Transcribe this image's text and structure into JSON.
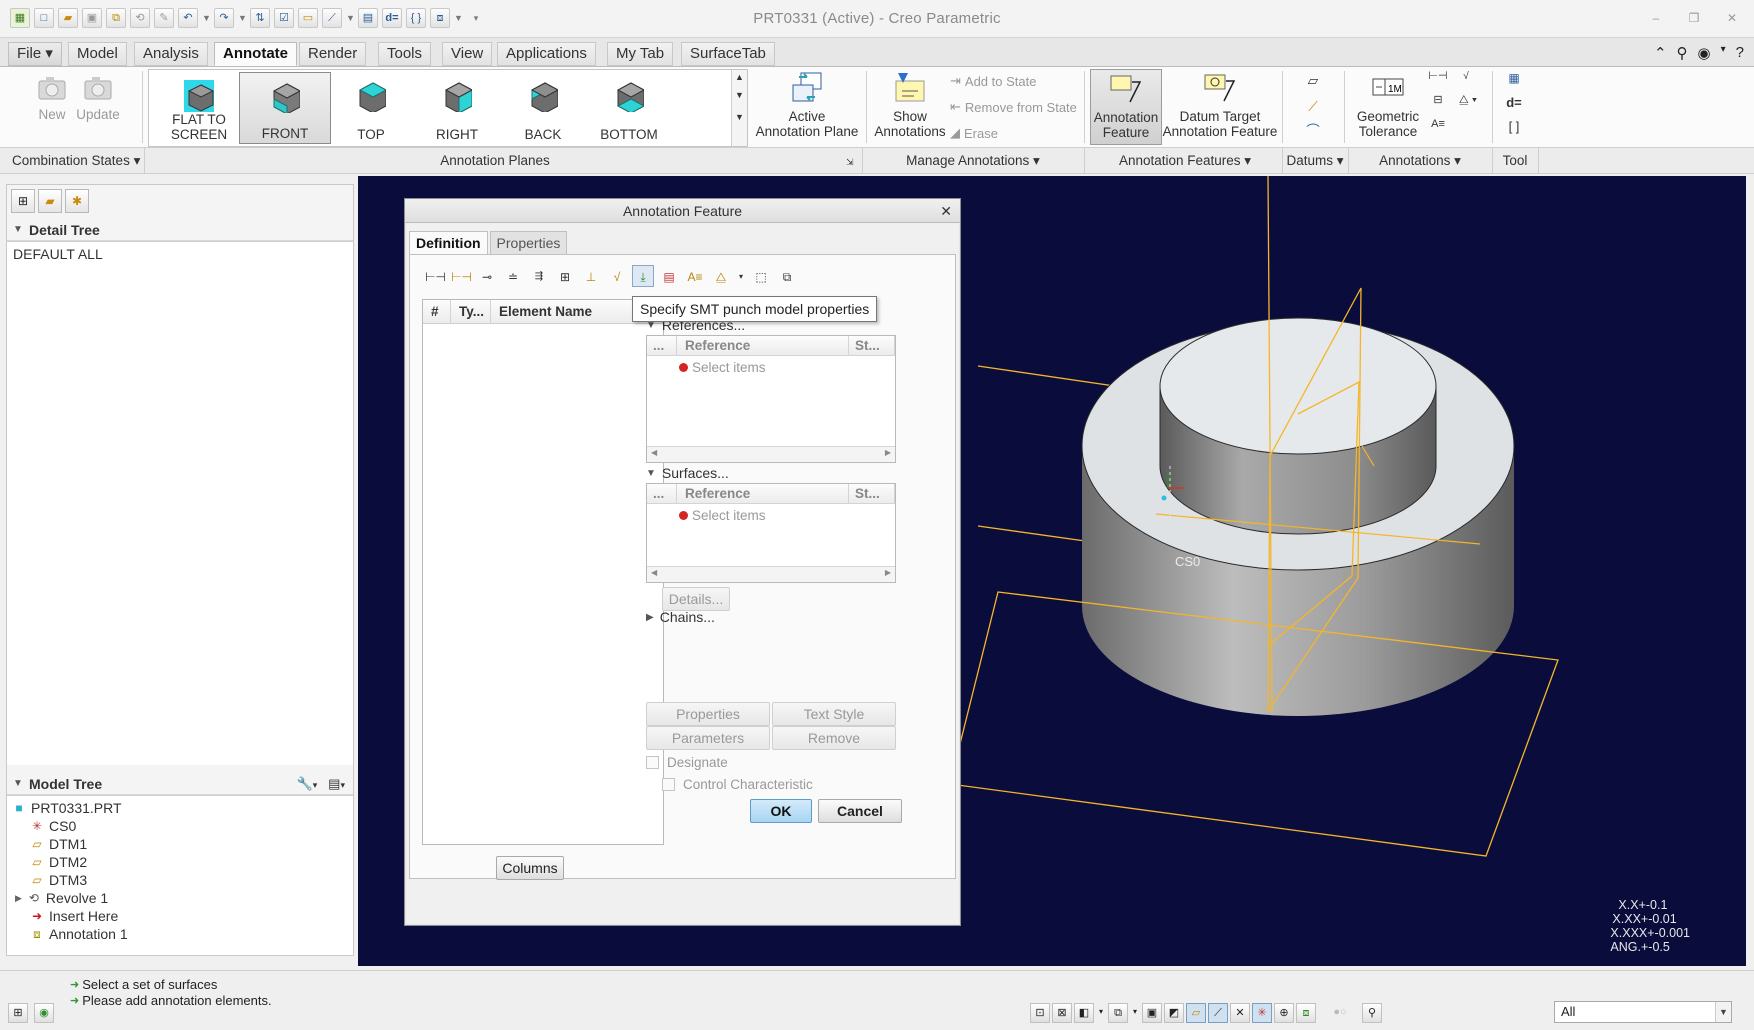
{
  "window": {
    "title": "PRT0331 (Active) - Creo Parametric"
  },
  "ribbon_tabs": [
    "File",
    "Model",
    "Analysis",
    "Annotate",
    "Render",
    "Tools",
    "View",
    "Applications",
    "My Tab",
    "SurfaceTab"
  ],
  "ribbon": {
    "new_label": "New",
    "update_label": "Update",
    "views": [
      {
        "label": "FLAT TO SCREEN",
        "selected": false
      },
      {
        "label": "FRONT",
        "selected": true
      },
      {
        "label": "TOP",
        "selected": false
      },
      {
        "label": "RIGHT",
        "selected": false
      },
      {
        "label": "BACK",
        "selected": false
      },
      {
        "label": "BOTTOM",
        "selected": false
      }
    ],
    "active_plane_label_1": "Active",
    "active_plane_label_2": "Annotation Plane",
    "show_label_1": "Show",
    "show_label_2": "Annotations",
    "add_to_state": "Add to State",
    "remove_from_state": "Remove from State",
    "erase": "Erase",
    "annotation_feature_1": "Annotation",
    "annotation_feature_2": "Feature",
    "datum_target_1": "Datum Target",
    "datum_target_2": "Annotation Feature",
    "geom_tol_1": "Geometric",
    "geom_tol_2": "Tolerance"
  },
  "groups": {
    "combination_states": "Combination States",
    "annotation_planes": "Annotation Planes",
    "manage_annotations": "Manage Annotations",
    "annotation_features": "Annotation Features",
    "datums": "Datums",
    "annotations": "Annotations",
    "tool": "Tool"
  },
  "detail_tree": {
    "header": "Detail Tree",
    "items": [
      "DEFAULT ALL"
    ]
  },
  "model_tree": {
    "header": "Model Tree",
    "items": [
      "PRT0331.PRT",
      "CS0",
      "DTM1",
      "DTM2",
      "DTM3",
      "Revolve 1",
      "Insert Here",
      "Annotation 1"
    ]
  },
  "dialog": {
    "title": "Annotation Feature",
    "tabs": [
      "Definition",
      "Properties"
    ],
    "table_headers": [
      "#",
      "Ty...",
      "Element Name"
    ],
    "tooltip": "Specify SMT punch model properties",
    "references_label": "References...",
    "surfaces_label": "Surfaces...",
    "collector_headers": [
      "...",
      "Reference",
      "St..."
    ],
    "select_items": "Select items",
    "details_button": "Details...",
    "chains_label": "Chains...",
    "properties_button": "Properties",
    "text_style_button": "Text Style",
    "parameters_button": "Parameters",
    "remove_button": "Remove",
    "designate_label": "Designate",
    "control_char_label": "Control Characteristic",
    "columns_button": "Columns",
    "ok_button": "OK",
    "cancel_button": "Cancel"
  },
  "viewport": {
    "csys_label": "CS0",
    "tolerances": [
      "X.X+-0.1",
      "X.XX+-0.01",
      "X.XXX+-0.001",
      "ANG.+-0.5"
    ]
  },
  "status": {
    "messages": [
      "Select a set of surfaces",
      "Please add annotation elements."
    ],
    "filter_value": "All"
  },
  "colors": {
    "viewport_bg": "#0a0c3c",
    "datum_plane": "#f5b52a",
    "accent_blue": "#a7d5f2"
  }
}
